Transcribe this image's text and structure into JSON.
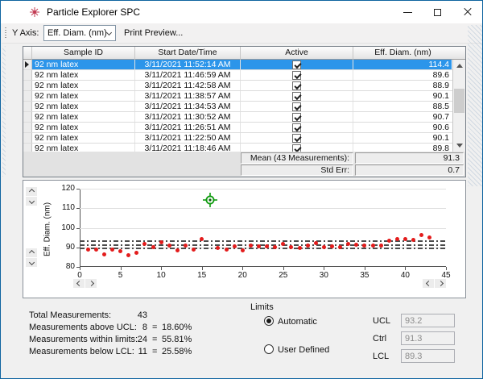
{
  "window": {
    "title": "Particle Explorer SPC"
  },
  "toolbar": {
    "y_axis_label": "Y Axis:",
    "y_axis_value": "Eff. Diam. (nm)",
    "print_preview_label": "Print Preview..."
  },
  "table": {
    "columns": [
      "Sample ID",
      "Start Date/Time",
      "Active",
      "Eff. Diam. (nm)"
    ],
    "rows": [
      {
        "sample_id": "92 nm latex",
        "start": "3/11/2021 11:52:14 AM",
        "active": true,
        "value": "114.4",
        "selected": true
      },
      {
        "sample_id": "92 nm latex",
        "start": "3/11/2021 11:46:59 AM",
        "active": true,
        "value": "89.6",
        "selected": false
      },
      {
        "sample_id": "92 nm latex",
        "start": "3/11/2021 11:42:58 AM",
        "active": true,
        "value": "88.9",
        "selected": false
      },
      {
        "sample_id": "92 nm latex",
        "start": "3/11/2021 11:38:57 AM",
        "active": true,
        "value": "90.1",
        "selected": false
      },
      {
        "sample_id": "92 nm latex",
        "start": "3/11/2021 11:34:53 AM",
        "active": true,
        "value": "88.5",
        "selected": false
      },
      {
        "sample_id": "92 nm latex",
        "start": "3/11/2021 11:30:52 AM",
        "active": true,
        "value": "90.7",
        "selected": false
      },
      {
        "sample_id": "92 nm latex",
        "start": "3/11/2021 11:26:51 AM",
        "active": true,
        "value": "90.6",
        "selected": false
      },
      {
        "sample_id": "92 nm latex",
        "start": "3/11/2021 11:22:50 AM",
        "active": true,
        "value": "90.1",
        "selected": false
      },
      {
        "sample_id": "92 nm latex",
        "start": "3/11/2021 11:18:46 AM",
        "active": true,
        "value": "89.8",
        "selected": false
      }
    ],
    "summary": {
      "mean_label": "Mean (43 Measurements):",
      "mean_value": "91.3",
      "std_err_label": "Std Err:",
      "std_err_value": "0.7"
    }
  },
  "chart_data": {
    "type": "scatter",
    "title": "",
    "xlabel": "",
    "ylabel": "Eff. Diam. (nm)",
    "xlim": [
      0,
      45
    ],
    "ylim": [
      80,
      120
    ],
    "xticks": [
      0,
      5,
      10,
      15,
      20,
      25,
      30,
      35,
      40,
      45
    ],
    "yticks": [
      80,
      90,
      100,
      110,
      120
    ],
    "grid": true,
    "x": [
      1,
      2,
      3,
      4,
      5,
      6,
      7,
      8,
      9,
      10,
      11,
      12,
      13,
      14,
      15,
      16,
      17,
      18,
      19,
      20,
      21,
      22,
      23,
      24,
      25,
      26,
      27,
      28,
      29,
      30,
      31,
      32,
      33,
      34,
      35,
      36,
      37,
      38,
      39,
      40,
      41,
      42,
      43
    ],
    "values": [
      88.9,
      88.7,
      86.3,
      88.9,
      88.2,
      86.1,
      87.4,
      91.6,
      90.1,
      92.4,
      91.1,
      88.3,
      90.9,
      88.8,
      94.4,
      114.4,
      89.8,
      89.0,
      90.4,
      88.6,
      91.1,
      90.6,
      90.5,
      89.9,
      91.7,
      90.1,
      89.6,
      91.1,
      92.0,
      89.9,
      90.6,
      90.2,
      91.6,
      91.2,
      90.9,
      91.1,
      91.0,
      93.6,
      94.1,
      94.4,
      93.9,
      96.3,
      94.9
    ],
    "selected_index": 16,
    "limit_lines": {
      "ucl": 93.2,
      "ctrl": 91.3,
      "lcl": 89.3
    },
    "point_color": "#e31c1c",
    "selected_color": "#0f9b0f"
  },
  "stats": {
    "rows": [
      {
        "label": "Total Measurements:",
        "count": "43",
        "eq": "",
        "pct": ""
      },
      {
        "label": "Measurements above UCL:",
        "count": "8",
        "eq": "=",
        "pct": "18.60%"
      },
      {
        "label": "Measurements within limits:",
        "count": "24",
        "eq": "=",
        "pct": "55.81%"
      },
      {
        "label": "Measurements below LCL:",
        "count": "11",
        "eq": "=",
        "pct": "25.58%"
      }
    ]
  },
  "limits": {
    "title": "Limits",
    "options": [
      {
        "label": "Automatic",
        "selected": true
      },
      {
        "label": "User Defined",
        "selected": false
      }
    ],
    "fields": [
      {
        "label": "UCL",
        "value": "93.2"
      },
      {
        "label": "Ctrl",
        "value": "91.3"
      },
      {
        "label": "LCL",
        "value": "89.3"
      }
    ]
  },
  "colors": {
    "selection_blue": "#2c95ea",
    "window_border": "#0f64a0"
  }
}
